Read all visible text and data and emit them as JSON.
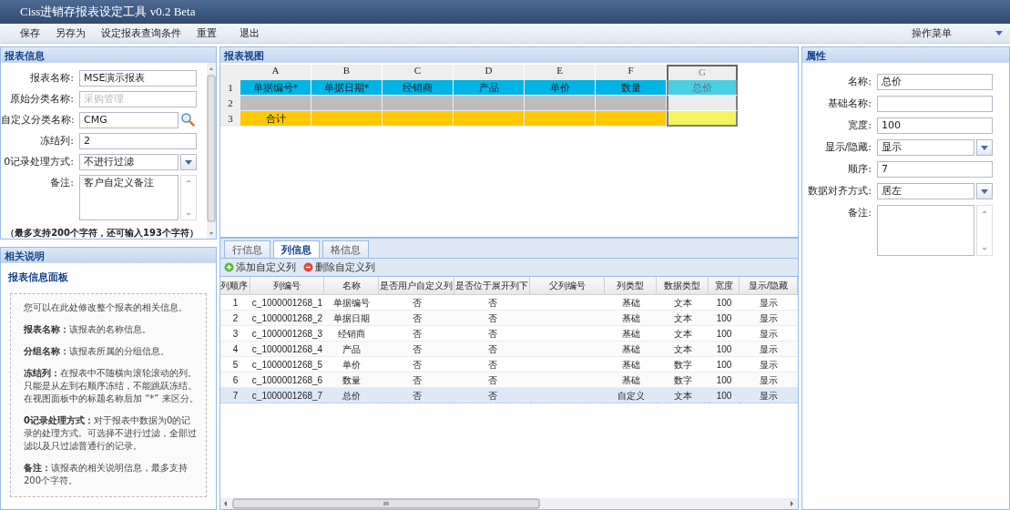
{
  "window": {
    "title": "Ciss进销存报表设定工具  v0.2 Beta"
  },
  "menu": {
    "items": [
      {
        "label": "保存"
      },
      {
        "label": "另存为"
      },
      {
        "label": "设定报表查询条件"
      },
      {
        "label": "重置"
      },
      {
        "label": "退出"
      }
    ],
    "right_menu": "操作菜单"
  },
  "report_info": {
    "title": "报表信息",
    "fields": [
      {
        "label": "报表名称:",
        "value": "MSE演示报表",
        "kind": "text"
      },
      {
        "label": "原始分类名称:",
        "value": "采购管理",
        "kind": "disabled"
      },
      {
        "label": "自定义分类名称:",
        "value": "CMG",
        "kind": "search"
      },
      {
        "label": "冻结列:",
        "value": "2",
        "kind": "text"
      },
      {
        "label": "0记录处理方式:",
        "value": "不进行过滤",
        "kind": "select"
      },
      {
        "label": "备注:",
        "value": "客户自定义备注",
        "kind": "textarea"
      }
    ],
    "note": "（最多支持200个字符，还可输入193个字符）"
  },
  "help": {
    "title": "相关说明",
    "subtitle": "报表信息面板",
    "paragraphs": [
      "您可以在此处修改整个报表的相关信息。",
      "**报表名称：**该报表的名称信息。",
      "**分组名称：**该报表所属的分组信息。",
      "**冻结列：**在报表中不随横向滚轮滚动的列。只能是从左到右顺序冻结，不能跳跃冻结。在视图面板中的标题名称后加 “*” 来区分。",
      "**0记录处理方式：**对于报表中数据为0的记录的处理方式。可选择不进行过滤，全部过滤以及只过滤普通行的记录。",
      "**备注：**该报表的相关说明信息，最多支持200个字符。"
    ]
  },
  "report_view": {
    "title": "报表视图",
    "columns": [
      {
        "label": "A",
        "selected": false
      },
      {
        "label": "B",
        "selected": false
      },
      {
        "label": "C",
        "selected": false
      },
      {
        "label": "D",
        "selected": false
      },
      {
        "label": "E",
        "selected": false
      },
      {
        "label": "F",
        "selected": false
      },
      {
        "label": "G",
        "selected": true
      }
    ],
    "rows": [
      {
        "number": "1",
        "kind": "header",
        "cells": [
          "单据编号*",
          "单据日期*",
          "经销商",
          "产品",
          "单价",
          "数量",
          "总价"
        ]
      },
      {
        "number": "2",
        "kind": "blank"
      },
      {
        "number": "3",
        "kind": "total",
        "cells": [
          "合计"
        ]
      }
    ]
  },
  "tabs": [
    {
      "label": "行信息",
      "selected": false
    },
    {
      "label": "列信息",
      "selected": true
    },
    {
      "label": "格信息",
      "selected": false
    }
  ],
  "toolbar": [
    {
      "label": "添加自定义列",
      "kind": "add"
    },
    {
      "label": "删除自定义列",
      "kind": "remove"
    }
  ],
  "table": {
    "columns": [
      "列顺序",
      "列编号",
      "名称",
      "是否用户自定义列",
      "是否位于展开列下",
      "父列编号",
      "列类型",
      "数据类型",
      "宽度",
      "显示/隐藏"
    ],
    "rows": [
      {
        "cells": [
          "1",
          "c_1000001268_1",
          "单据编号",
          "否",
          "否",
          "",
          "基础",
          "文本",
          "100",
          "显示"
        ],
        "selected": false
      },
      {
        "cells": [
          "2",
          "c_1000001268_2",
          "单据日期",
          "否",
          "否",
          "",
          "基础",
          "文本",
          "100",
          "显示"
        ],
        "selected": false
      },
      {
        "cells": [
          "3",
          "c_1000001268_3",
          "经销商",
          "否",
          "否",
          "",
          "基础",
          "文本",
          "100",
          "显示"
        ],
        "selected": false
      },
      {
        "cells": [
          "4",
          "c_1000001268_4",
          "产品",
          "否",
          "否",
          "",
          "基础",
          "文本",
          "100",
          "显示"
        ],
        "selected": false
      },
      {
        "cells": [
          "5",
          "c_1000001268_5",
          "单价",
          "否",
          "否",
          "",
          "基础",
          "数字",
          "100",
          "显示"
        ],
        "selected": false
      },
      {
        "cells": [
          "6",
          "c_1000001268_6",
          "数量",
          "否",
          "否",
          "",
          "基础",
          "数字",
          "100",
          "显示"
        ],
        "selected": false
      },
      {
        "cells": [
          "7",
          "c_1000001268_7",
          "总价",
          "否",
          "否",
          "",
          "自定义",
          "文本",
          "100",
          "显示"
        ],
        "selected": true
      }
    ]
  },
  "properties": {
    "title": "属性",
    "fields": [
      {
        "label": "名称:",
        "value": "总价",
        "kind": "text"
      },
      {
        "label": "基础名称:",
        "kind": "text"
      },
      {
        "label": "宽度:",
        "value": "100",
        "kind": "text"
      },
      {
        "label": "显示/隐藏:",
        "value": "显示",
        "kind": "select"
      },
      {
        "label": "顺序:",
        "value": "7",
        "kind": "text"
      },
      {
        "label": "数据对齐方式:",
        "value": "居左",
        "kind": "select"
      },
      {
        "label": "备注:",
        "kind": "textarea"
      }
    ]
  }
}
